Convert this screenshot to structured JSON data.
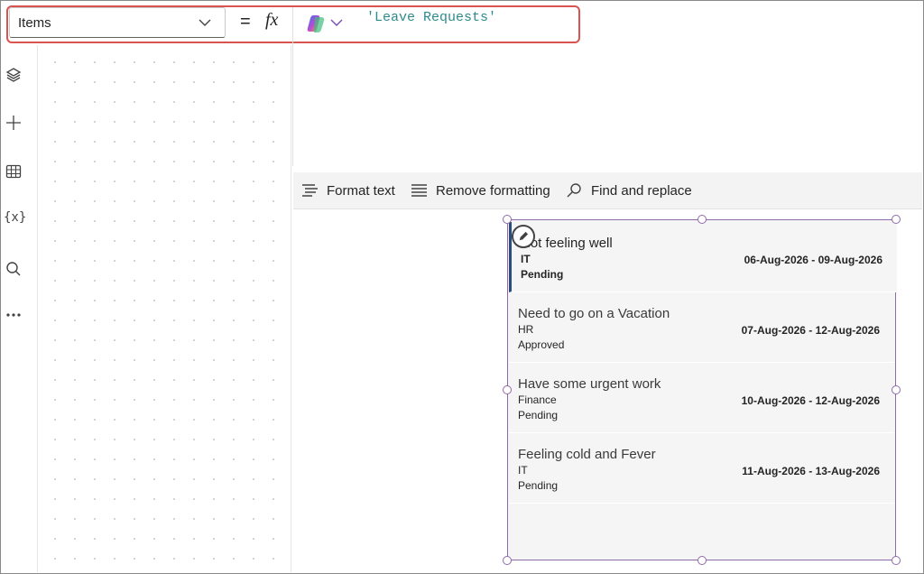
{
  "formula_bar": {
    "property": "Items",
    "equals": "=",
    "fx": "fx",
    "formula": "'Leave Requests'"
  },
  "left_rail": {
    "icons": [
      "layers-icon",
      "add-icon",
      "table-icon",
      "variables-icon",
      "search-icon",
      "more-icon"
    ],
    "variables_label": "{x}"
  },
  "format_toolbar": {
    "format_text": "Format text",
    "remove_formatting": "Remove formatting",
    "find_replace": "Find and replace"
  },
  "gallery": {
    "rows": [
      {
        "title": "Not feeling well",
        "dept": "IT",
        "status": "Pending",
        "dates": "06-Aug-2026 - 09-Aug-2026"
      },
      {
        "title": "Need to go on a Vacation",
        "dept": "HR",
        "status": "Approved",
        "dates": "07-Aug-2026 - 12-Aug-2026"
      },
      {
        "title": "Have some urgent work",
        "dept": "Finance",
        "status": "Pending",
        "dates": "10-Aug-2026 - 12-Aug-2026"
      },
      {
        "title": "Feeling cold and Fever",
        "dept": "IT",
        "status": "Pending",
        "dates": "11-Aug-2026 - 13-Aug-2026"
      }
    ]
  },
  "colors": {
    "highlight_outline": "#d9534f",
    "selection": "#8e6aa8",
    "selected_row_bar": "#2b4c7e",
    "formula_text": "#2e8b8b"
  }
}
